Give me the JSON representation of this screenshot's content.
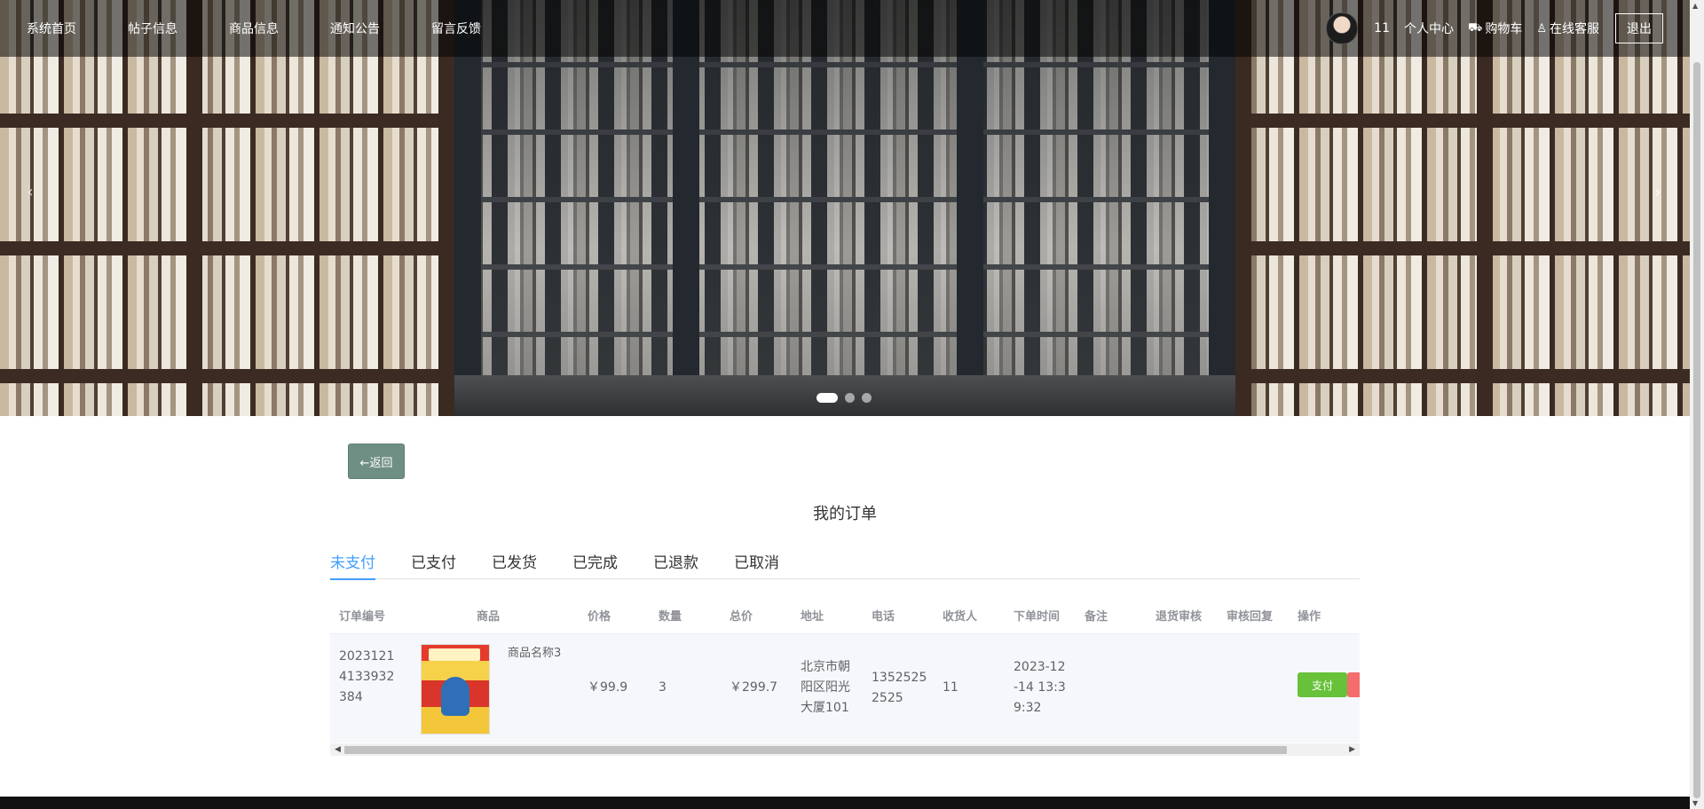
{
  "nav": {
    "links": [
      "系统首页",
      "帖子信息",
      "商品信息",
      "通知公告",
      "留言反馈"
    ],
    "user_number": "11",
    "personal_center": "个人中心",
    "cart": "购物车",
    "customer_service": "在线客服",
    "logout": "退出"
  },
  "carousel": {
    "prev_arrow": "‹",
    "next_arrow": "›",
    "slides": 3,
    "active_slide": 1
  },
  "page": {
    "back_label": "←返回",
    "title": "我的订单"
  },
  "tabs": [
    {
      "label": "未支付",
      "active": true
    },
    {
      "label": "已支付",
      "active": false
    },
    {
      "label": "已发货",
      "active": false
    },
    {
      "label": "已完成",
      "active": false
    },
    {
      "label": "已退款",
      "active": false
    },
    {
      "label": "已取消",
      "active": false
    }
  ],
  "table": {
    "headers": [
      "订单编号",
      "商品",
      "价格",
      "数量",
      "总价",
      "地址",
      "电话",
      "收货人",
      "下单时间",
      "备注",
      "退货审核",
      "审核回复",
      "操作"
    ],
    "rows": [
      {
        "order_no": "20231214133932384",
        "order_no_lines": [
          "2023121",
          "4133932",
          "384"
        ],
        "product_name": "商品名称3",
        "price": "￥99.9",
        "quantity": "3",
        "total": "￥299.7",
        "address_lines": [
          "北京市朝",
          "阳区阳光",
          "大厦101"
        ],
        "phone_lines": [
          "1352525",
          "2525"
        ],
        "receiver": "11",
        "time_lines": [
          "2023-12",
          "-14 13:3",
          "9:32"
        ],
        "note": "",
        "return_review": "",
        "review_reply": "",
        "pay_label": "支付"
      }
    ]
  },
  "colors": {
    "accent": "#409eff",
    "back_button": "#6f8f85",
    "pay_button": "#67c23a",
    "cancel_button": "#f56c6c"
  }
}
